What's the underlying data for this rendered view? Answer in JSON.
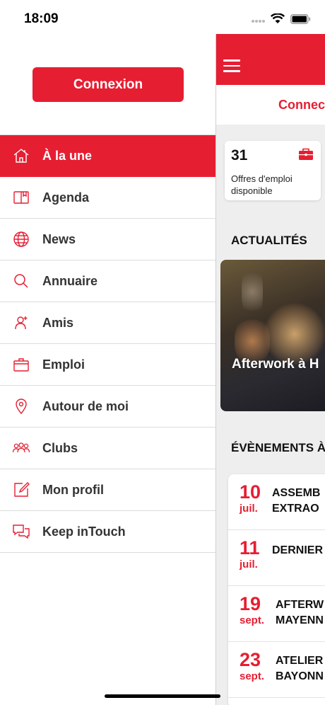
{
  "status_bar": {
    "time": "18:09"
  },
  "drawer": {
    "login_label": "Connexion",
    "items": [
      {
        "label": "À la une",
        "icon": "home-icon",
        "active": true
      },
      {
        "label": "Agenda",
        "icon": "calendar-book-icon"
      },
      {
        "label": "News",
        "icon": "globe-icon"
      },
      {
        "label": "Annuaire",
        "icon": "search-icon"
      },
      {
        "label": "Amis",
        "icon": "person-add-icon"
      },
      {
        "label": "Emploi",
        "icon": "briefcase-icon"
      },
      {
        "label": "Autour de moi",
        "icon": "location-pin-icon"
      },
      {
        "label": "Clubs",
        "icon": "group-icon"
      },
      {
        "label": "Mon profil",
        "icon": "edit-profile-icon"
      },
      {
        "label": "Keep inTouch",
        "icon": "chat-bubbles-icon"
      }
    ]
  },
  "main": {
    "connect_text": "Connect",
    "job_card": {
      "count": "31",
      "label": "Offres d'emploi disponible"
    },
    "news_section_title": "ACTUALITÉS",
    "news_caption": "Afterwork à H",
    "events_section_title": "ÉVÈNEMENTS À",
    "events": [
      {
        "day": "10",
        "month": "juil.",
        "title_line1": "ASSEMB",
        "title_line2": "EXTRAO"
      },
      {
        "day": "11",
        "month": "juil.",
        "title_line1": "DERNIER",
        "title_line2": ""
      },
      {
        "day": "19",
        "month": "sept.",
        "title_line1": "AFTERW",
        "title_line2": "MAYENN"
      },
      {
        "day": "23",
        "month": "sept.",
        "title_line1": "ATELIER",
        "title_line2": "BAYONN"
      }
    ]
  },
  "colors": {
    "accent": "#e61e32",
    "background": "#eeeeee"
  }
}
